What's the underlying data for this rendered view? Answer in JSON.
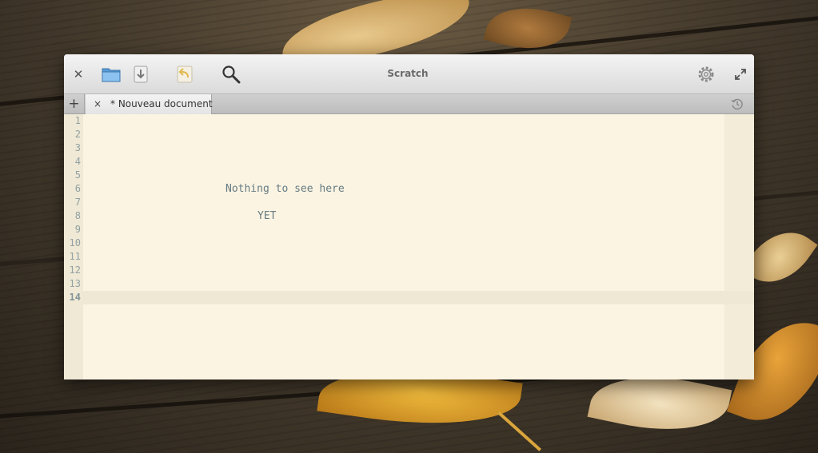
{
  "window": {
    "title": "Scratch"
  },
  "toolbar": {
    "close_icon": "close-icon",
    "open_icon": "folder-open-icon",
    "save_icon": "save-download-icon",
    "revert_icon": "revert-undo-icon",
    "search_icon": "search-icon",
    "settings_icon": "gear-icon",
    "fullscreen_icon": "fullscreen-icon"
  },
  "tabs": {
    "new_tab_label": "+",
    "items": [
      {
        "label": "* Nouveau document",
        "close_label": "×",
        "active": true
      }
    ],
    "history_icon": "history-icon"
  },
  "editor": {
    "line_numbers": [
      "1",
      "2",
      "3",
      "4",
      "5",
      "6",
      "7",
      "8",
      "9",
      "10",
      "11",
      "12",
      "13",
      "14"
    ],
    "current_line": 14,
    "lines": [
      {
        "line": 6,
        "text": "Nothing to see here"
      },
      {
        "line": 8,
        "text": "YET"
      }
    ]
  },
  "colors": {
    "editor_background": "#fbf4e2",
    "gutter_background": "#efe9d6",
    "text": "#657b83",
    "line_number": "#93a1a1",
    "current_line_highlight": "#eee8d4"
  }
}
